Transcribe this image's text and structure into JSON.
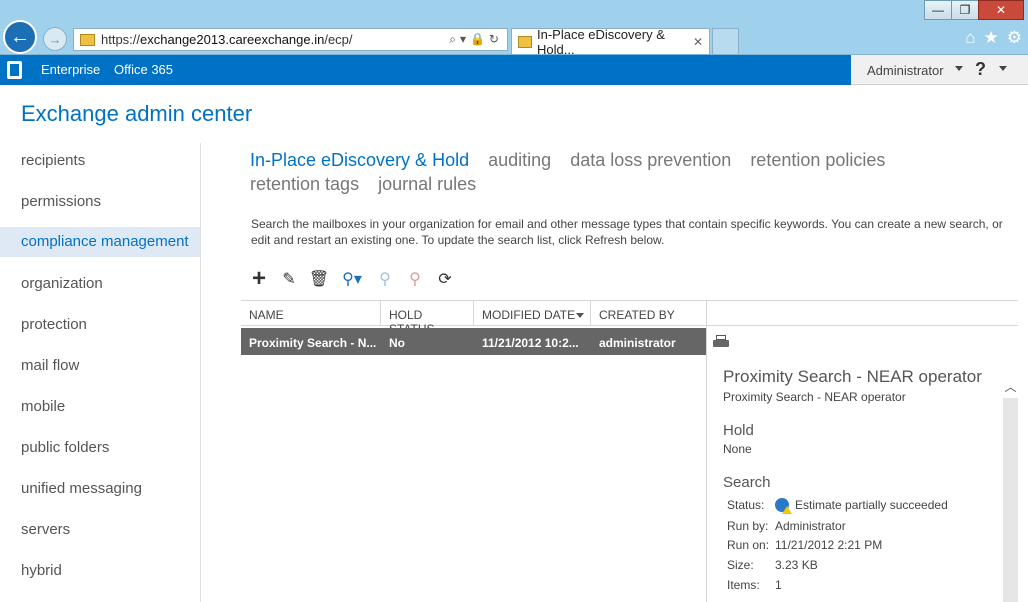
{
  "browser": {
    "url_prefix": "https://",
    "url_host": "exchange2013.careexchange.in",
    "url_path": "/ecp/",
    "url_tools": "⌕▾🔒↻",
    "tab_title": "In-Place eDiscovery & Hold...",
    "tab_close": "✕",
    "back_glyph": "←",
    "forward_glyph": "→",
    "window_buttons": {
      "minimize": "—",
      "restore": "❐",
      "close": "✕"
    },
    "toolbar_icons": {
      "home": "⌂",
      "favorites": "★",
      "settings": "⚙"
    }
  },
  "navbar": {
    "enterprise": "Enterprise",
    "office365": "Office 365",
    "user": "Administrator",
    "help": "?"
  },
  "page": {
    "title": "Exchange admin center"
  },
  "leftnav": {
    "items": [
      {
        "label": "recipients"
      },
      {
        "label": "permissions"
      },
      {
        "label": "compliance management"
      },
      {
        "label": "organization"
      },
      {
        "label": "protection"
      },
      {
        "label": "mail flow"
      },
      {
        "label": "mobile"
      },
      {
        "label": "public folders"
      },
      {
        "label": "unified messaging"
      },
      {
        "label": "servers"
      },
      {
        "label": "hybrid"
      }
    ]
  },
  "subtabs": {
    "items": [
      {
        "label": "In-Place eDiscovery & Hold"
      },
      {
        "label": "auditing"
      },
      {
        "label": "data loss prevention"
      },
      {
        "label": "retention policies"
      },
      {
        "label": "retention tags"
      },
      {
        "label": "journal rules"
      }
    ]
  },
  "description": "Search the mailboxes in your organization for email and other message types that contain specific keywords. You can create a new search, or edit and restart an existing one. To update the search list, click Refresh below.",
  "toolbar": {
    "add": "+",
    "edit": "✎",
    "delete": "🗑",
    "search": "⚲▾",
    "estimate": "⚲",
    "stop": "⚲",
    "refresh": "⟳"
  },
  "table": {
    "columns": [
      "NAME",
      "HOLD STATUS",
      "MODIFIED DATE",
      "CREATED BY"
    ],
    "rows": [
      {
        "name": "Proximity Search - N...",
        "hold_status": "No",
        "modified": "11/21/2012 10:2...",
        "created_by": "administrator"
      }
    ]
  },
  "details": {
    "title": "Proximity Search - NEAR operator",
    "subtitle": "Proximity Search - NEAR operator",
    "hold_heading": "Hold",
    "hold_value": "None",
    "search_heading": "Search",
    "status_label": "Status:",
    "status_value": "Estimate partially succeeded",
    "runby_label": "Run by:",
    "runby_value": "Administrator",
    "runon_label": "Run on:",
    "runon_value": "11/21/2012 2:21 PM",
    "size_label": "Size:",
    "size_value": "3.23 KB",
    "items_label": "Items:",
    "items_value": "1"
  },
  "colors": {
    "brand_blue": "#0072c6",
    "selected_row": "#666666",
    "chrome_blue": "#9fd0ec"
  }
}
